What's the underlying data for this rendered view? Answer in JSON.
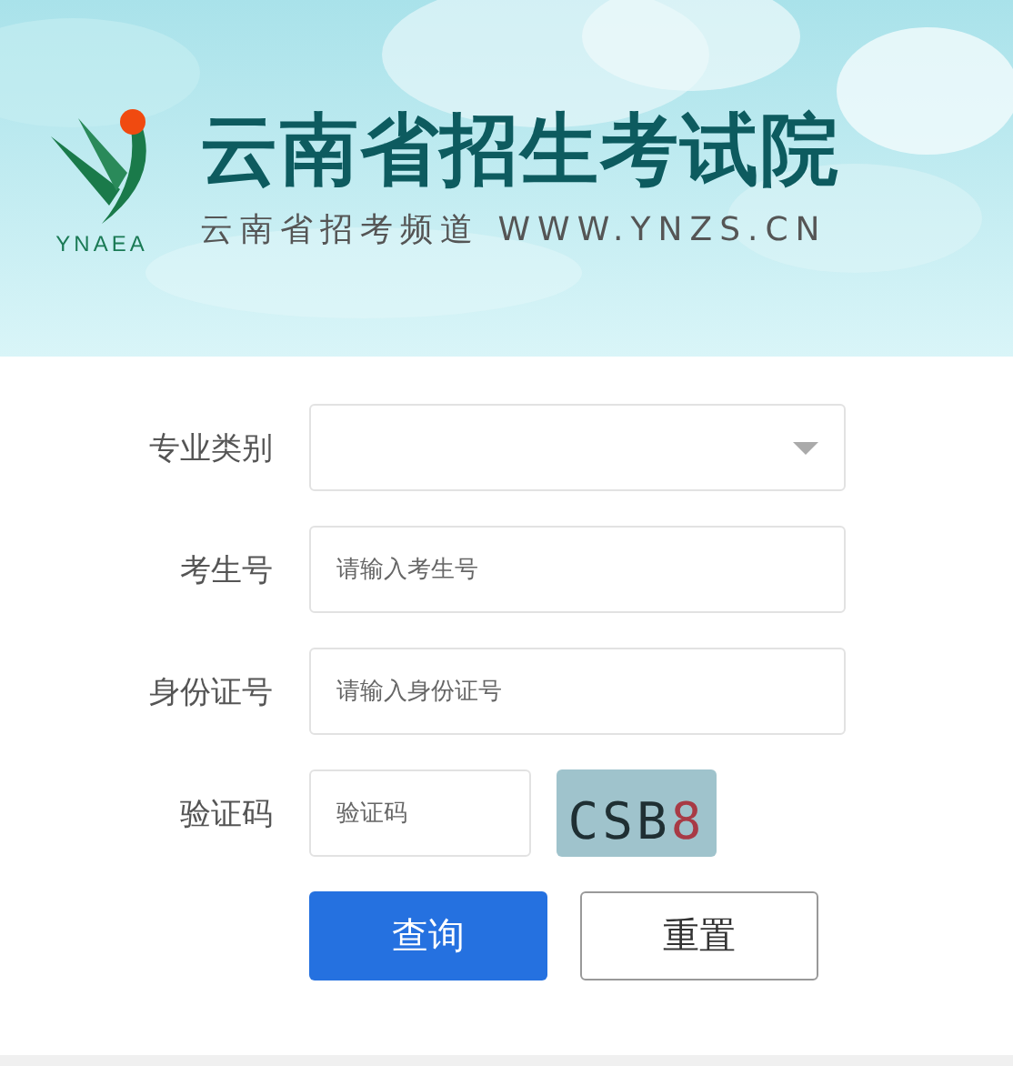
{
  "header": {
    "logo_text": "YNAEA",
    "title": "云南省招生考试院",
    "subtitle": "云南省招考频道 WWW.YNZS.CN"
  },
  "form": {
    "fields": [
      {
        "kind": "select",
        "label": "专业类别"
      },
      {
        "kind": "input",
        "label": "考生号",
        "placeholder": "请输入考生号"
      },
      {
        "kind": "input",
        "label": "身份证号",
        "placeholder": "请输入身份证号"
      },
      {
        "kind": "captcha",
        "label": "验证码",
        "placeholder": "验证码",
        "captcha": "CSB8"
      }
    ],
    "buttons": [
      {
        "kind": "primary",
        "label": "查询"
      },
      {
        "kind": "secondary",
        "label": "重置"
      }
    ]
  }
}
